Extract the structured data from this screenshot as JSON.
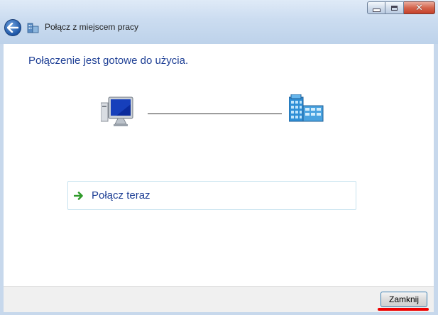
{
  "window": {
    "title": "Połącz z miejscem pracy",
    "icons": {
      "back": "back-arrow-icon",
      "title": "workplace-icon"
    }
  },
  "content": {
    "heading": "Połączenie jest gotowe do użycia.",
    "icons": {
      "left": "computer-icon",
      "right": "server-building-icon"
    },
    "connect_link": {
      "label": "Połącz teraz",
      "icon": "green-arrow-icon"
    }
  },
  "footer": {
    "close_label": "Zamknij"
  },
  "colors": {
    "heading": "#1e3f95",
    "frame": "#c7d8ec",
    "accent_mark": "#e00000"
  }
}
